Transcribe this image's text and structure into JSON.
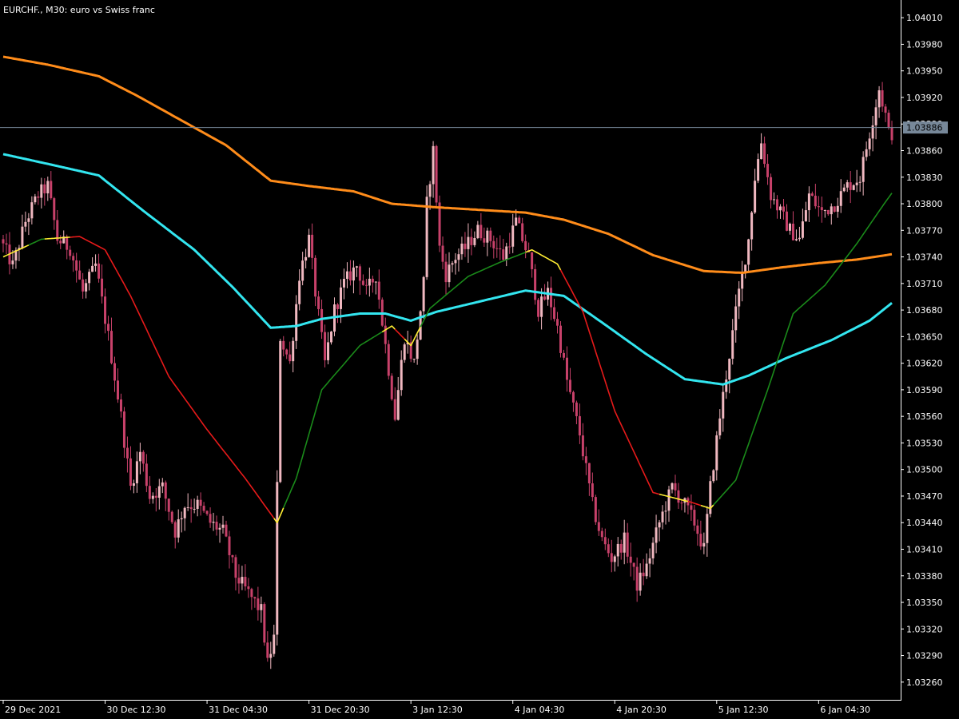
{
  "chart_data": {
    "type": "candlestick",
    "title": "EURCHF., M30:  euro vs Swiss franc",
    "ylim": [
      1.0324,
      1.0403
    ],
    "y_ticks": [
      "1.04010",
      "1.03980",
      "1.03950",
      "1.03920",
      "1.03890",
      "1.03860",
      "1.03830",
      "1.03800",
      "1.03770",
      "1.03740",
      "1.03710",
      "1.03680",
      "1.03650",
      "1.03620",
      "1.03590",
      "1.03560",
      "1.03530",
      "1.03500",
      "1.03470",
      "1.03440",
      "1.03410",
      "1.03380",
      "1.03350",
      "1.03320",
      "1.03290",
      "1.03260"
    ],
    "x_ticks": [
      {
        "label": "29 Dec 2021",
        "bar": 0
      },
      {
        "label": "30 Dec 12:30",
        "bar": 32
      },
      {
        "label": "31 Dec 04:30",
        "bar": 64
      },
      {
        "label": "31 Dec 20:30",
        "bar": 96
      },
      {
        "label": "3 Jan 12:30",
        "bar": 128
      },
      {
        "label": "4 Jan 04:30",
        "bar": 160
      },
      {
        "label": "4 Jan 20:30",
        "bar": 192
      },
      {
        "label": "5 Jan 12:30",
        "bar": 224
      },
      {
        "label": "6 Jan 04:30",
        "bar": 256
      }
    ],
    "current_price": "1.03886",
    "grid": false,
    "colors": {
      "background": "#000000",
      "candle_up": "#f0b8c0",
      "candle_down": "#c8416a",
      "ma_slow": "#ff8c1a",
      "ma_mid": "#33e6f0",
      "adaptive_up": "#1a8a1a",
      "adaptive_down": "#e61a1a",
      "adaptive_flat": "#ffee33",
      "axis": "#ffffff",
      "price_line": "#778899"
    },
    "series": [
      {
        "kind": "ma_slow",
        "points": [
          [
            0,
            1.03966
          ],
          [
            14,
            1.03957
          ],
          [
            30,
            1.03944
          ],
          [
            42,
            1.03922
          ],
          [
            56,
            1.03894
          ],
          [
            70,
            1.03866
          ],
          [
            84,
            1.03826
          ],
          [
            96,
            1.0382
          ],
          [
            110,
            1.03814
          ],
          [
            122,
            1.038
          ],
          [
            136,
            1.03796
          ],
          [
            150,
            1.03793
          ],
          [
            164,
            1.0379
          ],
          [
            176,
            1.03782
          ],
          [
            190,
            1.03766
          ],
          [
            204,
            1.03742
          ],
          [
            220,
            1.03724
          ],
          [
            232,
            1.03722
          ],
          [
            244,
            1.03728
          ],
          [
            256,
            1.03733
          ],
          [
            268,
            1.03737
          ],
          [
            279,
            1.03743
          ]
        ]
      },
      {
        "kind": "ma_mid",
        "points": [
          [
            0,
            1.03856
          ],
          [
            14,
            1.03845
          ],
          [
            30,
            1.03832
          ],
          [
            44,
            1.03792
          ],
          [
            60,
            1.03748
          ],
          [
            72,
            1.03706
          ],
          [
            84,
            1.0366
          ],
          [
            92,
            1.03662
          ],
          [
            100,
            1.0367
          ],
          [
            112,
            1.03676
          ],
          [
            120,
            1.03676
          ],
          [
            128,
            1.03668
          ],
          [
            136,
            1.03678
          ],
          [
            150,
            1.0369
          ],
          [
            164,
            1.03702
          ],
          [
            176,
            1.03696
          ],
          [
            188,
            1.03666
          ],
          [
            202,
            1.0363
          ],
          [
            214,
            1.03602
          ],
          [
            226,
            1.03596
          ],
          [
            234,
            1.03606
          ],
          [
            246,
            1.03626
          ],
          [
            260,
            1.03646
          ],
          [
            272,
            1.03668
          ],
          [
            279,
            1.03688
          ]
        ]
      },
      {
        "kind": "adaptive",
        "points": [
          [
            0,
            1.0374
          ],
          [
            12,
            1.0376
          ],
          [
            24,
            1.03763
          ],
          [
            32,
            1.03748
          ],
          [
            40,
            1.03696
          ],
          [
            52,
            1.03605
          ],
          [
            64,
            1.03545
          ],
          [
            76,
            1.0349
          ],
          [
            86,
            1.0344
          ],
          [
            92,
            1.0349
          ],
          [
            100,
            1.0359
          ],
          [
            112,
            1.0364
          ],
          [
            122,
            1.03662
          ],
          [
            128,
            1.0364
          ],
          [
            134,
            1.03682
          ],
          [
            146,
            1.03718
          ],
          [
            156,
            1.03734
          ],
          [
            166,
            1.03748
          ],
          [
            174,
            1.03732
          ],
          [
            182,
            1.03678
          ],
          [
            192,
            1.03566
          ],
          [
            204,
            1.03474
          ],
          [
            216,
            1.03463
          ],
          [
            222,
            1.03456
          ],
          [
            230,
            1.03488
          ],
          [
            240,
            1.0359
          ],
          [
            248,
            1.03676
          ],
          [
            258,
            1.03708
          ],
          [
            268,
            1.03755
          ],
          [
            276,
            1.03797
          ],
          [
            279,
            1.03812
          ]
        ],
        "segments": [
          {
            "from": 0,
            "to": 8,
            "state": "flat"
          },
          {
            "from": 8,
            "to": 13,
            "state": "up"
          },
          {
            "from": 13,
            "to": 21,
            "state": "flat"
          },
          {
            "from": 21,
            "to": 32,
            "state": "down"
          },
          {
            "from": 32,
            "to": 85,
            "state": "down"
          },
          {
            "from": 85,
            "to": 88,
            "state": "flat"
          },
          {
            "from": 88,
            "to": 119,
            "state": "up"
          },
          {
            "from": 119,
            "to": 123,
            "state": "flat"
          },
          {
            "from": 123,
            "to": 126,
            "state": "down"
          },
          {
            "from": 126,
            "to": 131,
            "state": "flat"
          },
          {
            "from": 131,
            "to": 164,
            "state": "up"
          },
          {
            "from": 164,
            "to": 175,
            "state": "flat"
          },
          {
            "from": 175,
            "to": 206,
            "state": "down"
          },
          {
            "from": 206,
            "to": 215,
            "state": "flat"
          },
          {
            "from": 215,
            "to": 219,
            "state": "down"
          },
          {
            "from": 219,
            "to": 223,
            "state": "flat"
          },
          {
            "from": 223,
            "to": 279,
            "state": "up"
          }
        ]
      },
      {
        "kind": "price_path",
        "points": [
          [
            0,
            1.0376
          ],
          [
            4,
            1.0373
          ],
          [
            8,
            1.0378
          ],
          [
            12,
            1.0381
          ],
          [
            15,
            1.0382
          ],
          [
            18,
            1.0376
          ],
          [
            22,
            1.0375
          ],
          [
            26,
            1.037
          ],
          [
            30,
            1.0373
          ],
          [
            34,
            1.0365
          ],
          [
            38,
            1.0356
          ],
          [
            41,
            1.0348
          ],
          [
            44,
            1.0352
          ],
          [
            47,
            1.0347
          ],
          [
            51,
            1.0348
          ],
          [
            55,
            1.0343
          ],
          [
            58,
            1.0346
          ],
          [
            62,
            1.0346
          ],
          [
            66,
            1.0344
          ],
          [
            70,
            1.0343
          ],
          [
            74,
            1.0338
          ],
          [
            78,
            1.0336
          ],
          [
            82,
            1.0334
          ],
          [
            84,
            1.0328
          ],
          [
            86,
            1.0331
          ],
          [
            87,
            1.0348
          ],
          [
            88,
            1.0365
          ],
          [
            91,
            1.0362
          ],
          [
            94,
            1.0372
          ],
          [
            97,
            1.0376
          ],
          [
            99,
            1.037
          ],
          [
            102,
            1.0362
          ],
          [
            105,
            1.0368
          ],
          [
            108,
            1.0371
          ],
          [
            112,
            1.0373
          ],
          [
            115,
            1.037
          ],
          [
            118,
            1.0372
          ],
          [
            121,
            1.0364
          ],
          [
            124,
            1.0356
          ],
          [
            127,
            1.0365
          ],
          [
            130,
            1.0362
          ],
          [
            133,
            1.0371
          ],
          [
            134,
            1.038
          ],
          [
            136,
            1.0386
          ],
          [
            138,
            1.0375
          ],
          [
            140,
            1.0372
          ],
          [
            143,
            1.0374
          ],
          [
            146,
            1.0375
          ],
          [
            150,
            1.0377
          ],
          [
            154,
            1.0376
          ],
          [
            158,
            1.0374
          ],
          [
            162,
            1.0378
          ],
          [
            166,
            1.0374
          ],
          [
            169,
            1.0368
          ],
          [
            172,
            1.037
          ],
          [
            175,
            1.0366
          ],
          [
            178,
            1.036
          ],
          [
            182,
            1.0354
          ],
          [
            186,
            1.0346
          ],
          [
            189,
            1.0342
          ],
          [
            192,
            1.034
          ],
          [
            196,
            1.0342
          ],
          [
            200,
            1.0337
          ],
          [
            203,
            1.0339
          ],
          [
            207,
            1.0344
          ],
          [
            211,
            1.0348
          ],
          [
            215,
            1.0346
          ],
          [
            218,
            1.0344
          ],
          [
            221,
            1.0341
          ],
          [
            223,
            1.0348
          ],
          [
            226,
            1.0356
          ],
          [
            229,
            1.0363
          ],
          [
            232,
            1.037
          ],
          [
            235,
            1.0376
          ],
          [
            237,
            1.0383
          ],
          [
            239,
            1.0387
          ],
          [
            242,
            1.0381
          ],
          [
            245,
            1.0379
          ],
          [
            248,
            1.0377
          ],
          [
            251,
            1.0376
          ],
          [
            254,
            1.0381
          ],
          [
            258,
            1.0379
          ],
          [
            262,
            1.038
          ],
          [
            266,
            1.0382
          ],
          [
            270,
            1.0383
          ],
          [
            273,
            1.0388
          ],
          [
            276,
            1.0393
          ],
          [
            278,
            1.039
          ],
          [
            279,
            1.0388
          ]
        ]
      }
    ]
  }
}
